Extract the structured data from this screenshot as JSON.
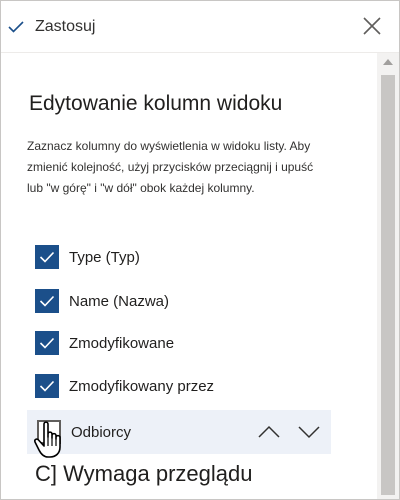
{
  "header": {
    "apply_label": "Zastosuj"
  },
  "panel": {
    "title": "Edytowanie kolumn widoku",
    "description": "Zaznacz kolumny do wyświetlenia w widoku listy. Aby zmienić kolejność, użyj przycisków przeciągnij i upuść lub \"w górę\" i \"w dół\" obok każdej kolumny."
  },
  "columns": [
    {
      "label": "Type (Typ)",
      "checked": true
    },
    {
      "label": "Name (Nazwa)",
      "checked": true
    },
    {
      "label": "Zmodyfikowane",
      "checked": true
    },
    {
      "label": "Zmodyfikowany przez",
      "checked": true
    },
    {
      "label": "Odbiorcy",
      "checked": false
    },
    {
      "label": "C] Wymaga przeglądu",
      "checked": false
    }
  ],
  "colors": {
    "checkbox": "#1b4f8a",
    "hover_row": "#edf1f8"
  },
  "icons": {
    "apply": "checkmark-icon",
    "close": "close-icon",
    "move_up": "chevron-up-icon",
    "move_down": "chevron-down-icon",
    "cursor": "hand-pointer-icon"
  }
}
